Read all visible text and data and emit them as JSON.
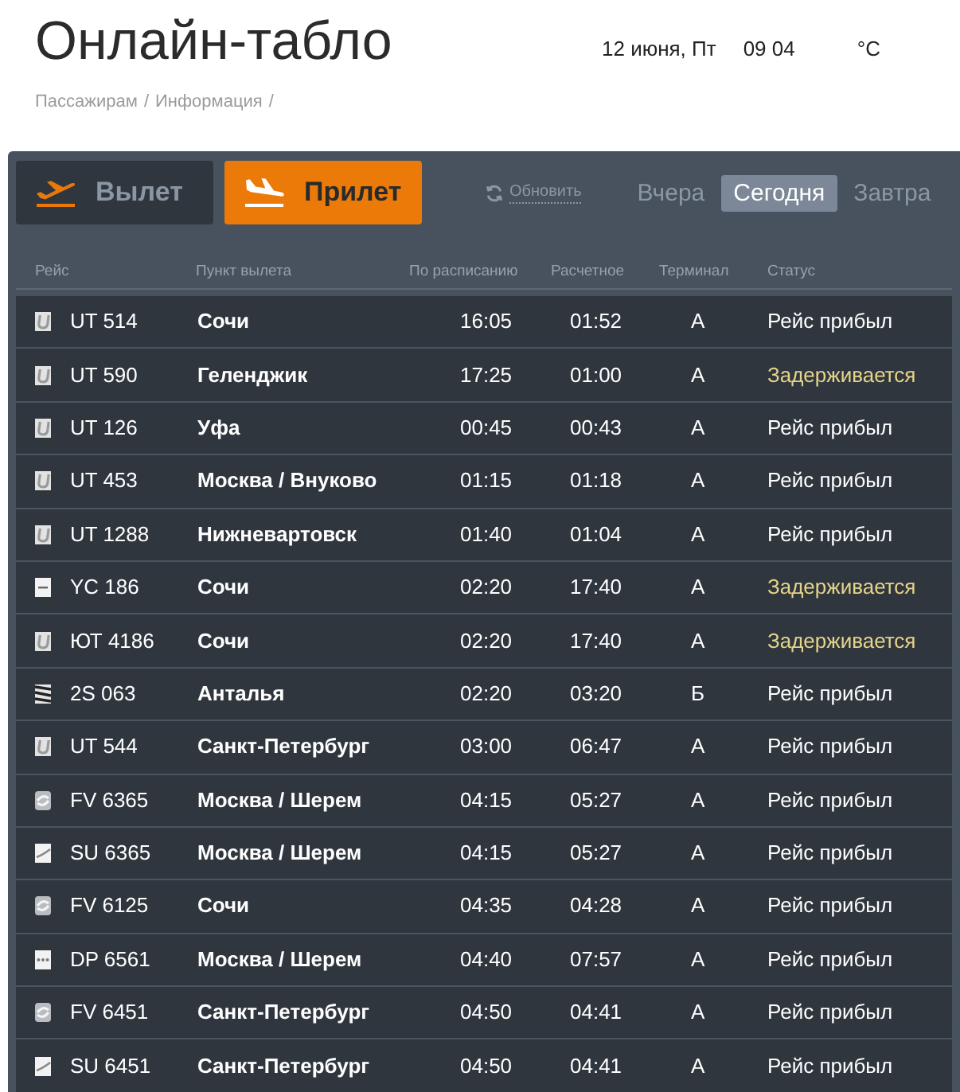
{
  "title": "Онлайн-табло",
  "date": "12 июня, Пт",
  "time": "09 04",
  "temperature": "°C",
  "breadcrumb": {
    "items": [
      "Пассажирам",
      "Информация"
    ],
    "separator": "/"
  },
  "direction_tabs": [
    {
      "label": "Вылет",
      "kind": "departure",
      "selected": false
    },
    {
      "label": "Прилет",
      "kind": "arrival",
      "selected": true
    }
  ],
  "refresh": {
    "label": "Обновить"
  },
  "day_tabs": [
    {
      "label": "Вчера",
      "selected": false
    },
    {
      "label": "Сегодня",
      "selected": true
    },
    {
      "label": "Завтра",
      "selected": false
    }
  ],
  "columns": [
    "Рейс",
    "Пункт вылета",
    "По расписанию",
    "Расчетное",
    "Терминал",
    "Статус"
  ],
  "rows": [
    {
      "kind": "u",
      "flight": "UT 514",
      "origin": "Сочи",
      "scheduled": "16:05",
      "estimated": "01:52",
      "terminal": "А",
      "status": "Рейс прибыл",
      "delayed": false
    },
    {
      "kind": "u",
      "flight": "UT 590",
      "origin": "Геленджик",
      "scheduled": "17:25",
      "estimated": "01:00",
      "terminal": "А",
      "status": "Задерживается",
      "delayed": true
    },
    {
      "kind": "u",
      "flight": "UT 126",
      "origin": "Уфа",
      "scheduled": "00:45",
      "estimated": "00:43",
      "terminal": "А",
      "status": "Рейс прибыл",
      "delayed": false
    },
    {
      "kind": "u",
      "flight": "UT 453",
      "origin": "Москва / Внуково",
      "scheduled": "01:15",
      "estimated": "01:18",
      "terminal": "А",
      "status": "Рейс прибыл",
      "delayed": false
    },
    {
      "kind": "u",
      "flight": "UT 1288",
      "origin": "Нижневартовск",
      "scheduled": "01:40",
      "estimated": "01:04",
      "terminal": "А",
      "status": "Рейс прибыл",
      "delayed": false
    },
    {
      "kind": "bar",
      "flight": "YC 186",
      "origin": "Сочи",
      "scheduled": "02:20",
      "estimated": "17:40",
      "terminal": "А",
      "status": "Задерживается",
      "delayed": true
    },
    {
      "kind": "u",
      "flight": "ЮТ 4186",
      "origin": "Сочи",
      "scheduled": "02:20",
      "estimated": "17:40",
      "terminal": "А",
      "status": "Задерживается",
      "delayed": true
    },
    {
      "kind": "stripes",
      "flight": "2S 063",
      "origin": "Анталья",
      "scheduled": "02:20",
      "estimated": "03:20",
      "terminal": "Б",
      "status": "Рейс прибыл",
      "delayed": false
    },
    {
      "kind": "u",
      "flight": "UT 544",
      "origin": "Санкт-Петербург",
      "scheduled": "03:00",
      "estimated": "06:47",
      "terminal": "А",
      "status": "Рейс прибыл",
      "delayed": false
    },
    {
      "kind": "swirl",
      "flight": "FV 6365",
      "origin": "Москва / Шерем",
      "scheduled": "04:15",
      "estimated": "05:27",
      "terminal": "А",
      "status": "Рейс прибыл",
      "delayed": false
    },
    {
      "kind": "swoosh",
      "flight": "SU 6365",
      "origin": "Москва / Шерем",
      "scheduled": "04:15",
      "estimated": "05:27",
      "terminal": "А",
      "status": "Рейс прибыл",
      "delayed": false
    },
    {
      "kind": "swirl",
      "flight": "FV 6125",
      "origin": "Сочи",
      "scheduled": "04:35",
      "estimated": "04:28",
      "terminal": "А",
      "status": "Рейс прибыл",
      "delayed": false
    },
    {
      "kind": "dots",
      "flight": "DP 6561",
      "origin": "Москва / Шерем",
      "scheduled": "04:40",
      "estimated": "07:57",
      "terminal": "А",
      "status": "Рейс прибыл",
      "delayed": false
    },
    {
      "kind": "swirl",
      "flight": "FV 6451",
      "origin": "Санкт-Петербург",
      "scheduled": "04:50",
      "estimated": "04:41",
      "terminal": "А",
      "status": "Рейс прибыл",
      "delayed": false
    },
    {
      "kind": "swoosh",
      "flight": "SU 6451",
      "origin": "Санкт-Петербург",
      "scheduled": "04:50",
      "estimated": "04:41",
      "terminal": "А",
      "status": "Рейс прибыл",
      "delayed": false
    }
  ]
}
